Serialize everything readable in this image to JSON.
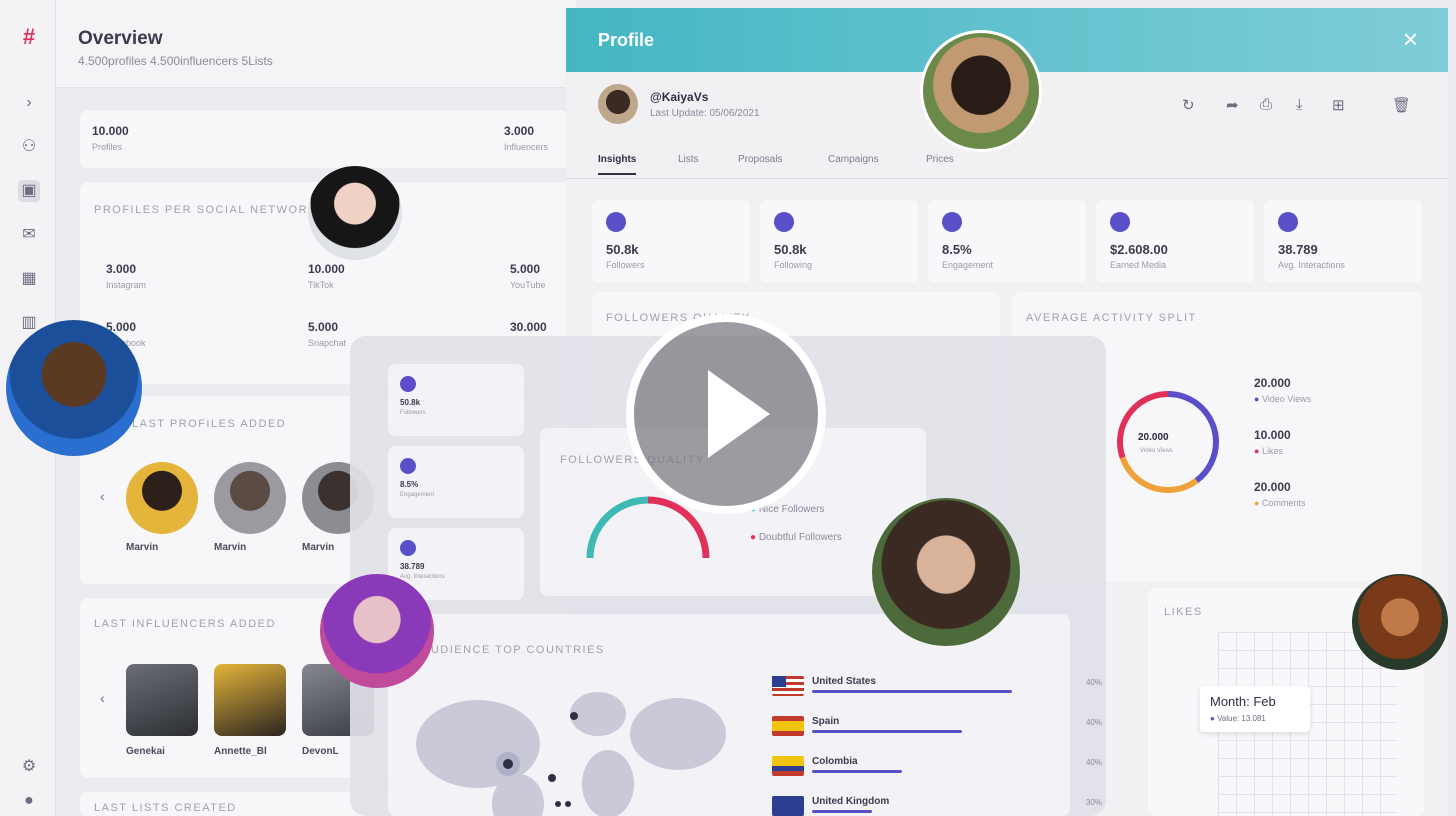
{
  "sidebar": {
    "icons": [
      "logo-icon",
      "chevron-right-icon",
      "users-icon",
      "profile-icon",
      "mail-icon",
      "calendar-icon",
      "chart-icon",
      "settings-icon",
      "help-icon"
    ]
  },
  "overview": {
    "title": "Overview",
    "subtitle": "4.500profiles 4.500influencers 5Lists",
    "stats": [
      {
        "value": "10.000",
        "label": "Profiles"
      },
      {
        "value": "3.000",
        "label": "Influencers"
      }
    ],
    "profiles_per_network": {
      "title": "PROFILES PER SOCIAL NETWORK",
      "items": [
        {
          "value": "3.000",
          "label": "Instagram"
        },
        {
          "value": "10.000",
          "label": "TikTok"
        },
        {
          "value": "5.000",
          "label": "YouTube"
        },
        {
          "value": "5.000",
          "label": "Facebook"
        },
        {
          "value": "5.000",
          "label": "Snapchat"
        },
        {
          "value": "30.000",
          "label": ""
        }
      ]
    },
    "last_profiles": {
      "title": "LAST PROFILES ADDED",
      "names": [
        "Marvin",
        "Marvin",
        "Marvin"
      ]
    },
    "last_influencers": {
      "title": "LAST INFLUENCERS ADDED",
      "names": [
        "Genekai",
        "Annette_Bl",
        "DevonL"
      ]
    },
    "last_lists_title": "LAST LISTS CREATED"
  },
  "profile": {
    "header_title": "Profile",
    "close": "×",
    "handle": "@KaiyaVs",
    "last_update": "Last Update: 05/06/2021",
    "tabs": [
      "Insights",
      "Lists",
      "Proposals",
      "Campaigns",
      "Prices"
    ],
    "metrics": [
      {
        "value": "50.8k",
        "label": "Followers"
      },
      {
        "value": "50.8k",
        "label": "Following"
      },
      {
        "value": "8.5%",
        "label": "Engagement"
      },
      {
        "value": "$2.608.00",
        "label": "Earned Media"
      },
      {
        "value": "38.789",
        "label": "Avg. Interactions"
      }
    ],
    "followers_quality_title": "FOLLOWERS QUALITY",
    "activity": {
      "title": "AVERAGE ACTIVITY SPLIT",
      "center_value": "20.000",
      "center_label": "Video Views",
      "legend": [
        {
          "value": "20.000",
          "label": "Video Views",
          "color": "#5a4fc9"
        },
        {
          "value": "10.000",
          "label": "Likes",
          "color": "#e0315a"
        },
        {
          "value": "20.000",
          "label": "Comments",
          "color": "#f0a23a"
        }
      ]
    },
    "likes": {
      "title": "LIKES",
      "tooltip_title": "Month: Feb",
      "tooltip_value": "Value: 13.081"
    }
  },
  "overlay": {
    "minis": [
      {
        "value": "50.8k",
        "label": "Followers"
      },
      {
        "value": "8.5%",
        "label": "Engagement"
      },
      {
        "value": "38.789",
        "label": "Avg. Interactions"
      }
    ],
    "quality_title": "FOLLOWERS QUALITY",
    "quality_legend": [
      {
        "label": "Nice Followers",
        "color": "#3fb9b3"
      },
      {
        "label": "Doubtful Followers",
        "color": "#e0315a"
      }
    ],
    "countries_title": "AUDIENCE TOP COUNTRIES",
    "countries": [
      {
        "name": "United States",
        "pct": "40%",
        "share": 0.4
      },
      {
        "name": "Spain",
        "pct": "40%",
        "share": 0.3
      },
      {
        "name": "Colombia",
        "pct": "40%",
        "share": 0.18
      },
      {
        "name": "United Kingdom",
        "pct": "30%",
        "share": 0.12
      }
    ]
  }
}
